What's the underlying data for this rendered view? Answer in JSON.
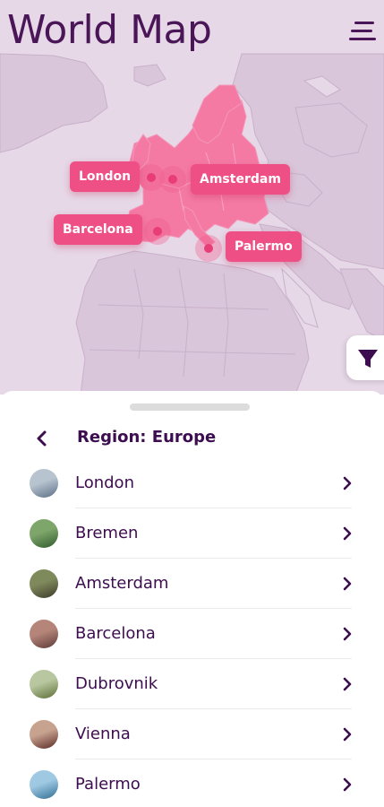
{
  "header": {
    "title": "World Map",
    "menu_icon": "hamburger-menu-icon"
  },
  "map": {
    "highlight_color": "#f47aa4",
    "pin_color": "#ee4f85",
    "pins": [
      {
        "label": "London"
      },
      {
        "label": "Amsterdam"
      },
      {
        "label": "Barcelona"
      },
      {
        "label": "Palermo"
      }
    ],
    "filter_icon": "filter-funnel-icon"
  },
  "sheet": {
    "back_icon": "chevron-left-icon",
    "region_title": "Region: Europe",
    "cities": [
      {
        "name": "London",
        "thumb_colors": [
          "#b7c3cf",
          "#5b6f86"
        ]
      },
      {
        "name": "Bremen",
        "thumb_colors": [
          "#7ea56a",
          "#2f5a2c"
        ]
      },
      {
        "name": "Amsterdam",
        "thumb_colors": [
          "#7f8a5c",
          "#3d3a2a"
        ]
      },
      {
        "name": "Barcelona",
        "thumb_colors": [
          "#b5857a",
          "#5c3a36"
        ]
      },
      {
        "name": "Dubrovnik",
        "thumb_colors": [
          "#b9c7a0",
          "#5d6e34"
        ]
      },
      {
        "name": "Vienna",
        "thumb_colors": [
          "#c7a28f",
          "#5a2a25"
        ]
      },
      {
        "name": "Palermo",
        "thumb_colors": [
          "#9fc9e3",
          "#2f6e94"
        ]
      }
    ],
    "row_chevron_icon": "chevron-right-icon"
  },
  "colors": {
    "primary_text": "#3c0d4f",
    "map_background": "#e6d8e7",
    "land": "#d9c6da"
  }
}
